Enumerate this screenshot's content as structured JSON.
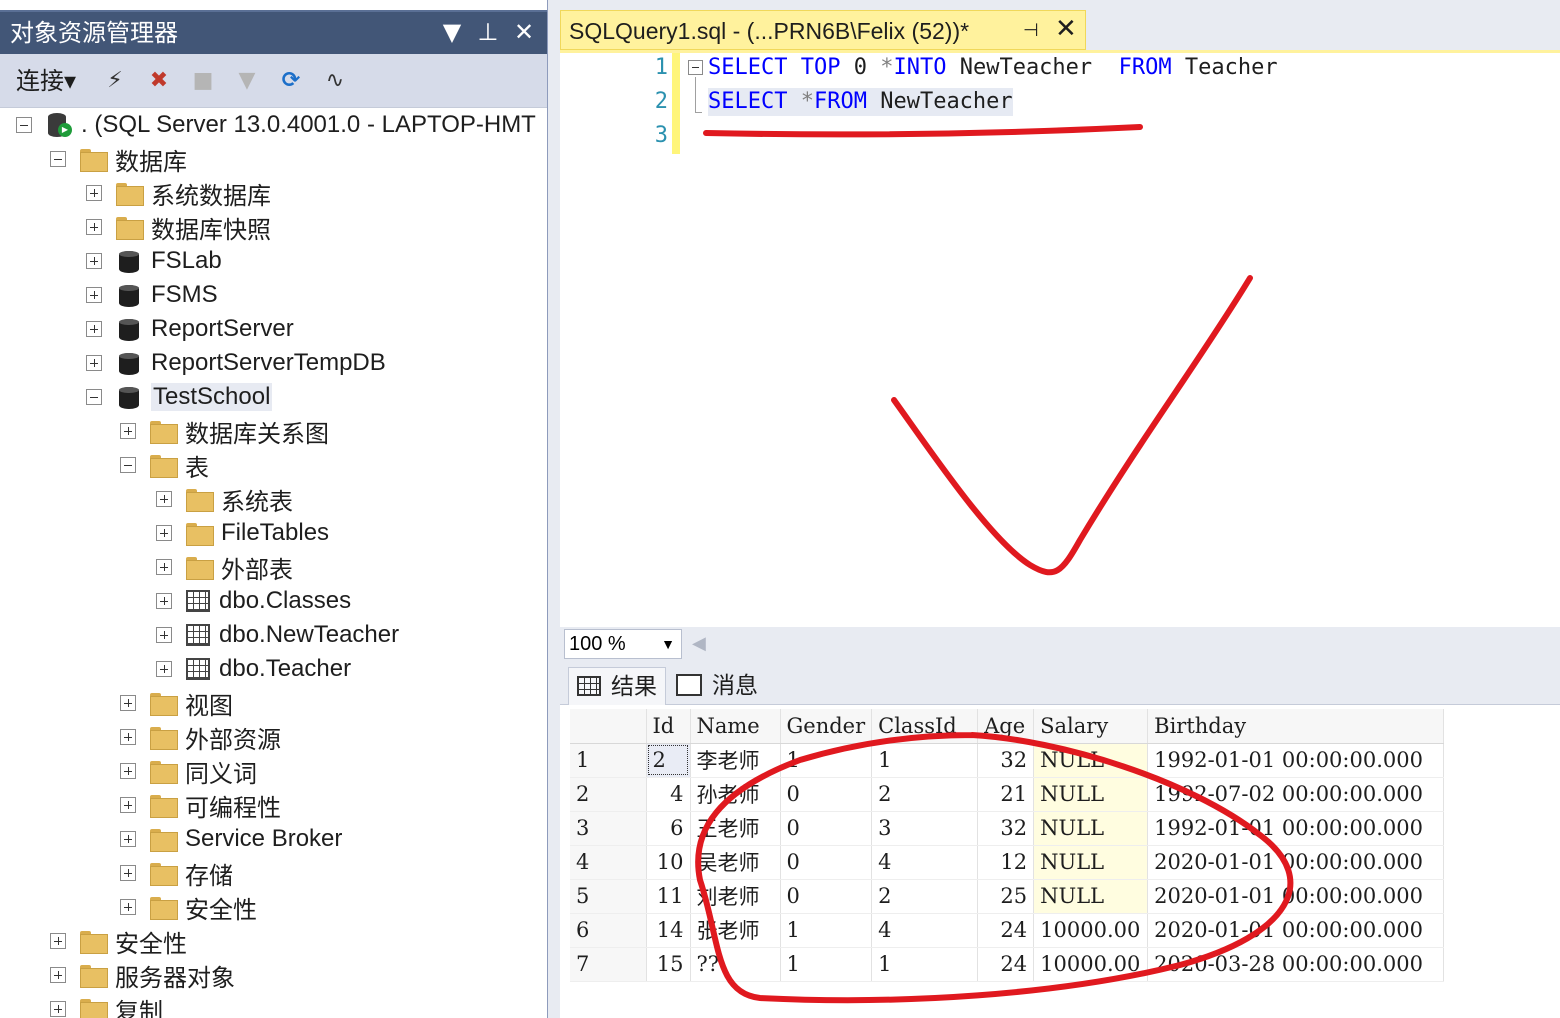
{
  "explorer": {
    "title": "对象资源管理器",
    "title_buttons": [
      "▼",
      "⊥",
      "✕"
    ],
    "toolbar": {
      "connect_label": "连接",
      "connect_arrow": "▾",
      "buttons": [
        {
          "name": "connect-icon",
          "glyph": "⚡"
        },
        {
          "name": "disconnect-icon",
          "glyph": "✖"
        },
        {
          "name": "stop-icon",
          "glyph": "■"
        },
        {
          "name": "filter-icon",
          "glyph": "▼"
        },
        {
          "name": "refresh-icon",
          "glyph": "⟳"
        },
        {
          "name": "activity-monitor-icon",
          "glyph": "∿"
        }
      ]
    },
    "tree": [
      {
        "label": ". (SQL Server 13.0.4001.0 - LAPTOP-HMT",
        "icon": "server",
        "level": 0,
        "state": "minus"
      },
      {
        "label": "数据库",
        "icon": "folder",
        "level": 1,
        "state": "minus"
      },
      {
        "label": "系统数据库",
        "icon": "folder",
        "level": 2,
        "state": "plus"
      },
      {
        "label": "数据库快照",
        "icon": "folder",
        "level": 2,
        "state": "plus"
      },
      {
        "label": "FSLab",
        "icon": "db",
        "level": 2,
        "state": "plus"
      },
      {
        "label": "FSMS",
        "icon": "db",
        "level": 2,
        "state": "plus"
      },
      {
        "label": "ReportServer",
        "icon": "db",
        "level": 2,
        "state": "plus"
      },
      {
        "label": "ReportServerTempDB",
        "icon": "db",
        "level": 2,
        "state": "plus"
      },
      {
        "label": "TestSchool",
        "icon": "db",
        "level": 2,
        "state": "minus",
        "selected": true
      },
      {
        "label": "数据库关系图",
        "icon": "folder",
        "level": 3,
        "state": "plus"
      },
      {
        "label": "表",
        "icon": "folder",
        "level": 3,
        "state": "minus"
      },
      {
        "label": "系统表",
        "icon": "folder",
        "level": 4,
        "state": "plus"
      },
      {
        "label": "FileTables",
        "icon": "folder",
        "level": 4,
        "state": "plus"
      },
      {
        "label": "外部表",
        "icon": "folder",
        "level": 4,
        "state": "plus"
      },
      {
        "label": "dbo.Classes",
        "icon": "table",
        "level": 4,
        "state": "plus"
      },
      {
        "label": "dbo.NewTeacher",
        "icon": "table",
        "level": 4,
        "state": "plus"
      },
      {
        "label": "dbo.Teacher",
        "icon": "table",
        "level": 4,
        "state": "plus"
      },
      {
        "label": "视图",
        "icon": "folder",
        "level": 3,
        "state": "plus"
      },
      {
        "label": "外部资源",
        "icon": "folder",
        "level": 3,
        "state": "plus"
      },
      {
        "label": "同义词",
        "icon": "folder",
        "level": 3,
        "state": "plus"
      },
      {
        "label": "可编程性",
        "icon": "folder",
        "level": 3,
        "state": "plus"
      },
      {
        "label": "Service Broker",
        "icon": "folder",
        "level": 3,
        "state": "plus"
      },
      {
        "label": "存储",
        "icon": "folder",
        "level": 3,
        "state": "plus"
      },
      {
        "label": "安全性",
        "icon": "folder",
        "level": 3,
        "state": "plus"
      },
      {
        "label": "安全性",
        "icon": "folder",
        "level": 1,
        "state": "plus"
      },
      {
        "label": "服务器对象",
        "icon": "folder",
        "level": 1,
        "state": "plus"
      },
      {
        "label": "复制",
        "icon": "folder",
        "level": 1,
        "state": "plus"
      }
    ]
  },
  "editor": {
    "tab_title": "SQLQuery1.sql - (...PRN6B\\Felix (52))*",
    "pin_glyph": "⊣",
    "close_glyph": "✕",
    "line_numbers": [
      "1",
      "2",
      "3"
    ],
    "lines": [
      [
        {
          "t": "SELECT",
          "c": "kw"
        },
        {
          "t": " ",
          "c": ""
        },
        {
          "t": "TOP",
          "c": "kw"
        },
        {
          "t": " 0 ",
          "c": ""
        },
        {
          "t": "*",
          "c": "gr"
        },
        {
          "t": "INTO",
          "c": "kw"
        },
        {
          "t": " NewTeacher  ",
          "c": ""
        },
        {
          "t": "FROM",
          "c": "kw"
        },
        {
          "t": " Teacher",
          "c": ""
        }
      ],
      [
        {
          "t": "SELECT",
          "c": "kw"
        },
        {
          "t": " ",
          "c": ""
        },
        {
          "t": "*",
          "c": "gr"
        },
        {
          "t": "FROM",
          "c": "kw"
        },
        {
          "t": " NewTeacher",
          "c": ""
        }
      ],
      []
    ]
  },
  "zoom": {
    "value": "100 %",
    "arrow": "▼",
    "scroll_glyph": "◀"
  },
  "results": {
    "tabs": [
      {
        "label": "结果",
        "active": true
      },
      {
        "label": "消息",
        "active": false
      }
    ],
    "columns": [
      "",
      "Id",
      "Name",
      "Gender",
      "ClassId",
      "Age",
      "Salary",
      "Birthday"
    ],
    "rows": [
      [
        "1",
        "2",
        "李老师",
        "1",
        "1",
        "32",
        "NULL",
        "1992-01-01 00:00:00.000"
      ],
      [
        "2",
        "4",
        "孙老师",
        "0",
        "2",
        "21",
        "NULL",
        "1992-07-02 00:00:00.000"
      ],
      [
        "3",
        "6",
        "王老师",
        "0",
        "3",
        "32",
        "NULL",
        "1992-01-01 00:00:00.000"
      ],
      [
        "4",
        "10",
        "吴老师",
        "0",
        "4",
        "12",
        "NULL",
        "2020-01-01 00:00:00.000"
      ],
      [
        "5",
        "11",
        "刘老师",
        "0",
        "2",
        "25",
        "NULL",
        "2020-01-01 00:00:00.000"
      ],
      [
        "6",
        "14",
        "张老师",
        "1",
        "4",
        "24",
        "10000.00",
        "2020-01-01 00:00:00.000"
      ],
      [
        "7",
        "15",
        "??",
        "1",
        "1",
        "24",
        "10000.00",
        "2020-03-28 00:00:00.000"
      ]
    ]
  },
  "colors": {
    "explorer_title_bg": "#425677",
    "editor_tab_bg": "#fff29d",
    "keyword": "#0000ff",
    "line_number": "#2b91af",
    "annotation_red": "#e0191f"
  }
}
